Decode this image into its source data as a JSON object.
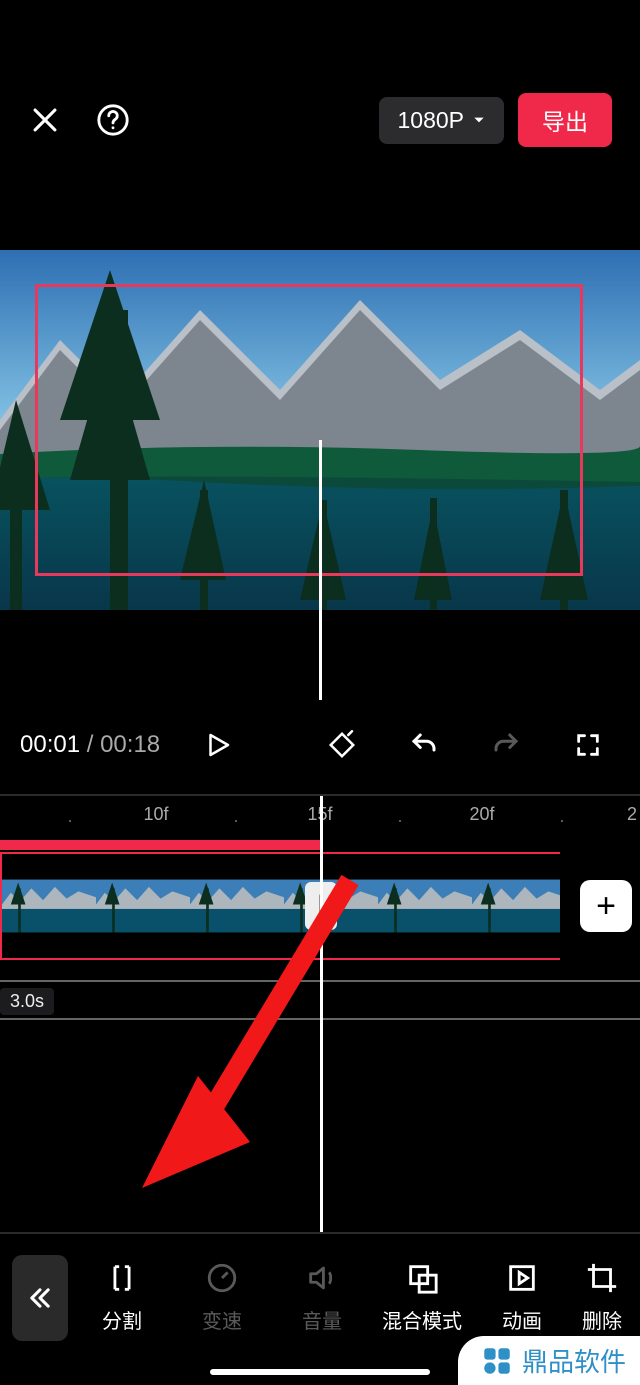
{
  "header": {
    "resolution_label": "1080P",
    "export_label": "导出"
  },
  "preview": {
    "selection_visible": true
  },
  "controls": {
    "current_time": "00:01",
    "total_time": "00:18"
  },
  "timeline": {
    "ruler_marks": [
      "10f",
      "15f",
      "20f"
    ],
    "ruler_edge": "2",
    "playhead_frame": "15f",
    "overlay_duration": "3.0s"
  },
  "tools": {
    "back_icon": "chevron-left-double",
    "items": [
      {
        "id": "split",
        "label": "分割",
        "enabled": true
      },
      {
        "id": "speed",
        "label": "变速",
        "enabled": false
      },
      {
        "id": "volume",
        "label": "音量",
        "enabled": false
      },
      {
        "id": "blend",
        "label": "混合模式",
        "enabled": true
      },
      {
        "id": "anim",
        "label": "动画",
        "enabled": true
      },
      {
        "id": "delete",
        "label": "删除",
        "enabled": true
      }
    ]
  },
  "watermark": {
    "text": "鼎品软件"
  }
}
